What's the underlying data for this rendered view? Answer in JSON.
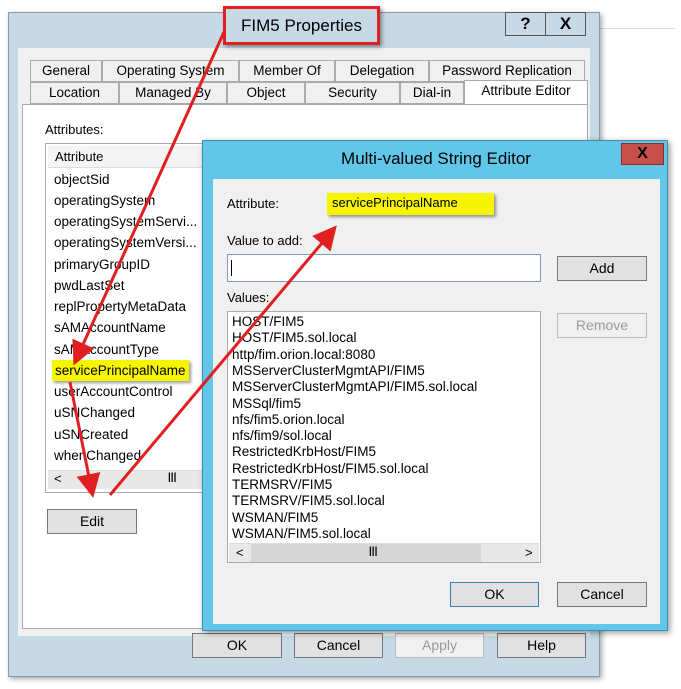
{
  "window": {
    "title": "FIM5 Properties",
    "help_label": "?",
    "close_label": "X"
  },
  "tabs_row1": [
    "General",
    "Operating System",
    "Member Of",
    "Delegation",
    "Password Replication"
  ],
  "tabs_row2": [
    "Location",
    "Managed By",
    "Object",
    "Security",
    "Dial-in",
    "Attribute Editor"
  ],
  "active_tab": "Attribute Editor",
  "attribute_editor": {
    "attributes_label": "Attributes:",
    "column_header": "Attribute",
    "items": [
      "objectSid",
      "operatingSystem",
      "operatingSystemServi...",
      "operatingSystemVersi...",
      "primaryGroupID",
      "pwdLastSet",
      "replPropertyMetaData",
      "sAMAccountName",
      "sAMAccountType",
      "servicePrincipalName",
      "userAccountControl",
      "uSNChanged",
      "uSNCreated",
      "whenChanged"
    ],
    "selected": "servicePrincipalName",
    "edit_label": "Edit"
  },
  "footer": {
    "ok": "OK",
    "cancel": "Cancel",
    "apply": "Apply",
    "help": "Help"
  },
  "dialog": {
    "title": "Multi-valued String Editor",
    "close_label": "X",
    "attribute_label": "Attribute:",
    "attribute_value": "servicePrincipalName",
    "value_to_add_label": "Value to add:",
    "value_to_add": "",
    "add_label": "Add",
    "values_label": "Values:",
    "values": [
      "HOST/FIM5",
      "HOST/FIM5.sol.local",
      "http/fim.orion.local:8080",
      "MSServerClusterMgmtAPI/FIM5",
      "MSServerClusterMgmtAPI/FIM5.sol.local",
      "MSSql/fim5",
      "nfs/fim5.orion.local",
      "nfs/fim9/sol.local",
      "RestrictedKrbHost/FIM5",
      "RestrictedKrbHost/FIM5.sol.local",
      "TERMSRV/FIM5",
      "TERMSRV/FIM5.sol.local",
      "WSMAN/FIM5",
      "WSMAN/FIM5.sol.local"
    ],
    "remove_label": "Remove",
    "ok": "OK",
    "cancel": "Cancel"
  },
  "colors": {
    "annotation": "#e02020",
    "highlight": "#f5f500",
    "dialog_frame": "#62c6e9",
    "close_button": "#c7504a"
  }
}
